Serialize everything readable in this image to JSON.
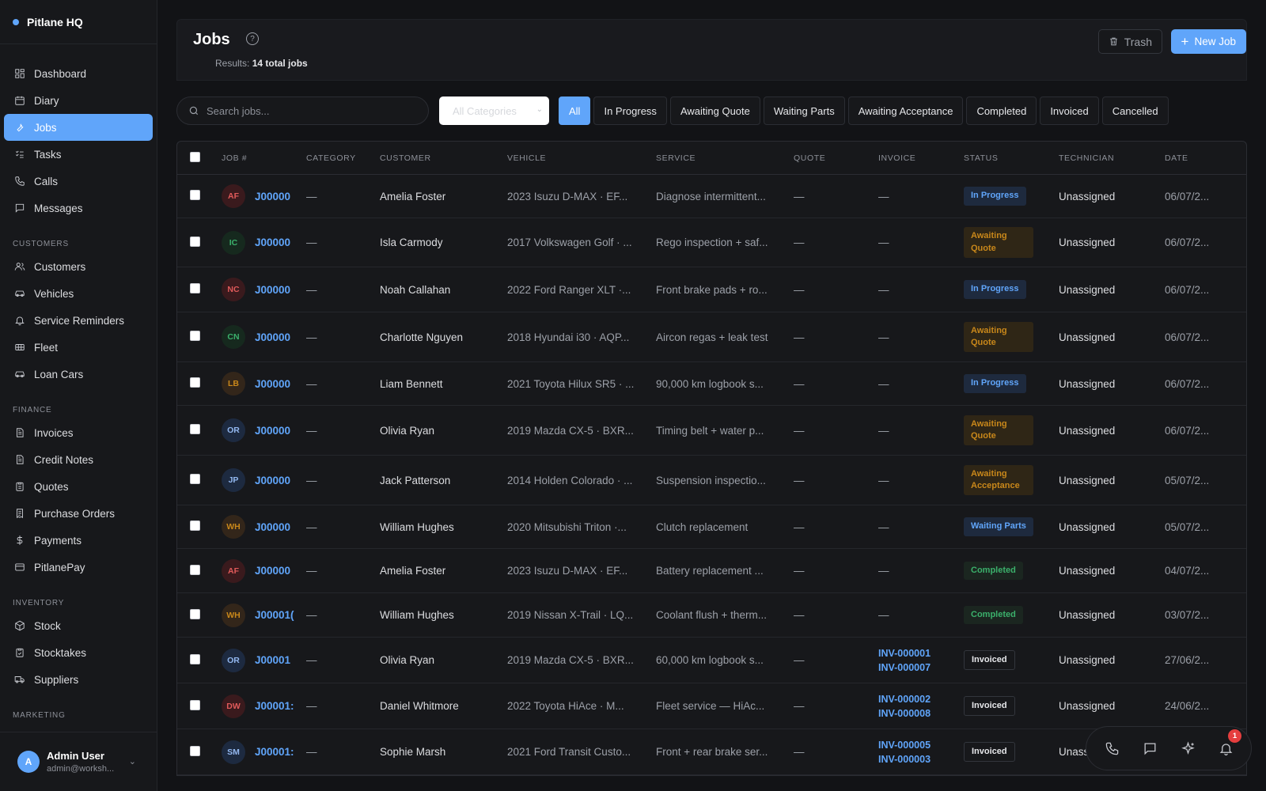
{
  "app": {
    "name": "Pitlane HQ"
  },
  "sidebar": {
    "main": [
      {
        "label": "Dashboard",
        "icon": "dashboard-icon"
      },
      {
        "label": "Diary",
        "icon": "calendar-icon"
      },
      {
        "label": "Jobs",
        "icon": "wrench-icon",
        "active": true
      },
      {
        "label": "Tasks",
        "icon": "checklist-icon"
      },
      {
        "label": "Calls",
        "icon": "phone-icon"
      },
      {
        "label": "Messages",
        "icon": "message-icon"
      }
    ],
    "customers_label": "CUSTOMERS",
    "customers": [
      {
        "label": "Customers",
        "icon": "users-icon"
      },
      {
        "label": "Vehicles",
        "icon": "car-icon"
      },
      {
        "label": "Service Reminders",
        "icon": "bell-icon"
      },
      {
        "label": "Fleet",
        "icon": "fleet-icon"
      },
      {
        "label": "Loan Cars",
        "icon": "car-icon"
      }
    ],
    "finance_label": "FINANCE",
    "finance": [
      {
        "label": "Invoices",
        "icon": "document-icon"
      },
      {
        "label": "Credit Notes",
        "icon": "document-icon"
      },
      {
        "label": "Quotes",
        "icon": "clipboard-icon"
      },
      {
        "label": "Purchase Orders",
        "icon": "receipt-icon"
      },
      {
        "label": "Payments",
        "icon": "dollar-icon"
      },
      {
        "label": "PitlanePay",
        "icon": "card-icon"
      }
    ],
    "inventory_label": "INVENTORY",
    "inventory": [
      {
        "label": "Stock",
        "icon": "box-icon"
      },
      {
        "label": "Stocktakes",
        "icon": "clipboard-check-icon"
      },
      {
        "label": "Suppliers",
        "icon": "truck-icon"
      }
    ],
    "marketing_label": "MARKETING",
    "user": {
      "initial": "A",
      "name": "Admin User",
      "email": "admin@worksh..."
    }
  },
  "header": {
    "title": "Jobs",
    "results_prefix": "Results:",
    "results_value": "14 total jobs",
    "trash_label": "Trash",
    "new_job_label": "New Job"
  },
  "toolbar": {
    "search_placeholder": "Search jobs...",
    "category_value": "All Categories",
    "filters": [
      "All",
      "In Progress",
      "Awaiting Quote",
      "Waiting Parts",
      "Awaiting Acceptance",
      "Completed",
      "Invoiced",
      "Cancelled"
    ],
    "active_filter": "All"
  },
  "table": {
    "columns": [
      "JOB #",
      "CATEGORY",
      "CUSTOMER",
      "VEHICLE",
      "SERVICE",
      "QUOTE",
      "INVOICE",
      "STATUS",
      "TECHNICIAN",
      "DATE"
    ],
    "rows": [
      {
        "initials": "AF",
        "avatar_color": "red",
        "job": "J00000",
        "category": "—",
        "customer": "Amelia Foster",
        "vehicle": "2023 Isuzu D-MAX · EF...",
        "service": "Diagnose intermittent...",
        "quote": "—",
        "invoice": [
          "—"
        ],
        "status": "In Progress",
        "status_type": "progress",
        "technician": "Unassigned",
        "date": "06/07/2..."
      },
      {
        "initials": "IC",
        "avatar_color": "green",
        "job": "J00000",
        "category": "—",
        "customer": "Isla Carmody",
        "vehicle": "2017 Volkswagen Golf · ...",
        "service": "Rego inspection + saf...",
        "quote": "—",
        "invoice": [
          "—"
        ],
        "status": "Awaiting Quote",
        "status_type": "awaiting",
        "technician": "Unassigned",
        "date": "06/07/2..."
      },
      {
        "initials": "NC",
        "avatar_color": "red",
        "job": "J00000",
        "category": "—",
        "customer": "Noah Callahan",
        "vehicle": "2022 Ford Ranger XLT ·...",
        "service": "Front brake pads + ro...",
        "quote": "—",
        "invoice": [
          "—"
        ],
        "status": "In Progress",
        "status_type": "progress",
        "technician": "Unassigned",
        "date": "06/07/2..."
      },
      {
        "initials": "CN",
        "avatar_color": "green",
        "job": "J00000",
        "category": "—",
        "customer": "Charlotte Nguyen",
        "vehicle": "2018 Hyundai i30 · AQP...",
        "service": "Aircon regas + leak test",
        "quote": "—",
        "invoice": [
          "—"
        ],
        "status": "Awaiting Quote",
        "status_type": "awaiting",
        "technician": "Unassigned",
        "date": "06/07/2..."
      },
      {
        "initials": "LB",
        "avatar_color": "amber",
        "job": "J00000",
        "category": "—",
        "customer": "Liam Bennett",
        "vehicle": "2021 Toyota Hilux SR5 · ...",
        "service": "90,000 km logbook s...",
        "quote": "—",
        "invoice": [
          "—"
        ],
        "status": "In Progress",
        "status_type": "progress",
        "technician": "Unassigned",
        "date": "06/07/2..."
      },
      {
        "initials": "OR",
        "avatar_color": "blue",
        "job": "J00000",
        "category": "—",
        "customer": "Olivia Ryan",
        "vehicle": "2019 Mazda CX-5 · BXR...",
        "service": "Timing belt + water p...",
        "quote": "—",
        "invoice": [
          "—"
        ],
        "status": "Awaiting Quote",
        "status_type": "awaiting",
        "technician": "Unassigned",
        "date": "06/07/2..."
      },
      {
        "initials": "JP",
        "avatar_color": "blue",
        "job": "J00000",
        "category": "—",
        "customer": "Jack Patterson",
        "vehicle": "2014 Holden Colorado · ...",
        "service": "Suspension inspectio...",
        "quote": "—",
        "invoice": [
          "—"
        ],
        "status": "Awaiting Acceptance",
        "status_type": "awaiting",
        "technician": "Unassigned",
        "date": "05/07/2..."
      },
      {
        "initials": "WH",
        "avatar_color": "amber",
        "job": "J00000",
        "category": "—",
        "customer": "William Hughes",
        "vehicle": "2020 Mitsubishi Triton ·...",
        "service": "Clutch replacement",
        "quote": "—",
        "invoice": [
          "—"
        ],
        "status": "Waiting Parts",
        "status_type": "parts",
        "technician": "Unassigned",
        "date": "05/07/2..."
      },
      {
        "initials": "AF",
        "avatar_color": "red",
        "job": "J00000",
        "category": "—",
        "customer": "Amelia Foster",
        "vehicle": "2023 Isuzu D-MAX · EF...",
        "service": "Battery replacement ...",
        "quote": "—",
        "invoice": [
          "—"
        ],
        "status": "Completed",
        "status_type": "completed",
        "technician": "Unassigned",
        "date": "04/07/2..."
      },
      {
        "initials": "WH",
        "avatar_color": "amber",
        "job": "J00001(",
        "category": "—",
        "customer": "William Hughes",
        "vehicle": "2019 Nissan X-Trail · LQ...",
        "service": "Coolant flush + therm...",
        "quote": "—",
        "invoice": [
          "—"
        ],
        "status": "Completed",
        "status_type": "completed",
        "technician": "Unassigned",
        "date": "03/07/2..."
      },
      {
        "initials": "OR",
        "avatar_color": "blue",
        "job": "J00001",
        "category": "—",
        "customer": "Olivia Ryan",
        "vehicle": "2019 Mazda CX-5 · BXR...",
        "service": "60,000 km logbook s...",
        "quote": "—",
        "invoice": [
          "INV-000001",
          "INV-000007"
        ],
        "status": "Invoiced",
        "status_type": "invoiced",
        "technician": "Unassigned",
        "date": "27/06/2..."
      },
      {
        "initials": "DW",
        "avatar_color": "red",
        "job": "J00001:",
        "category": "—",
        "customer": "Daniel Whitmore",
        "vehicle": "2022 Toyota HiAce · M...",
        "service": "Fleet service — HiAc...",
        "quote": "—",
        "invoice": [
          "INV-000002",
          "INV-000008"
        ],
        "status": "Invoiced",
        "status_type": "invoiced",
        "technician": "Unassigned",
        "date": "24/06/2..."
      },
      {
        "initials": "SM",
        "avatar_color": "blue",
        "job": "J00001:",
        "category": "—",
        "customer": "Sophie Marsh",
        "vehicle": "2021 Ford Transit Custo...",
        "service": "Front + rear brake ser...",
        "quote": "—",
        "invoice": [
          "INV-000005",
          "INV-000003"
        ],
        "status": "Invoiced",
        "status_type": "invoiced",
        "technician": "Unass",
        "date": ""
      }
    ]
  },
  "fab": {
    "notification_count": "1"
  },
  "colors": {
    "accent": "#60a5fa",
    "background": "#121316",
    "sidebar": "#17181b"
  }
}
